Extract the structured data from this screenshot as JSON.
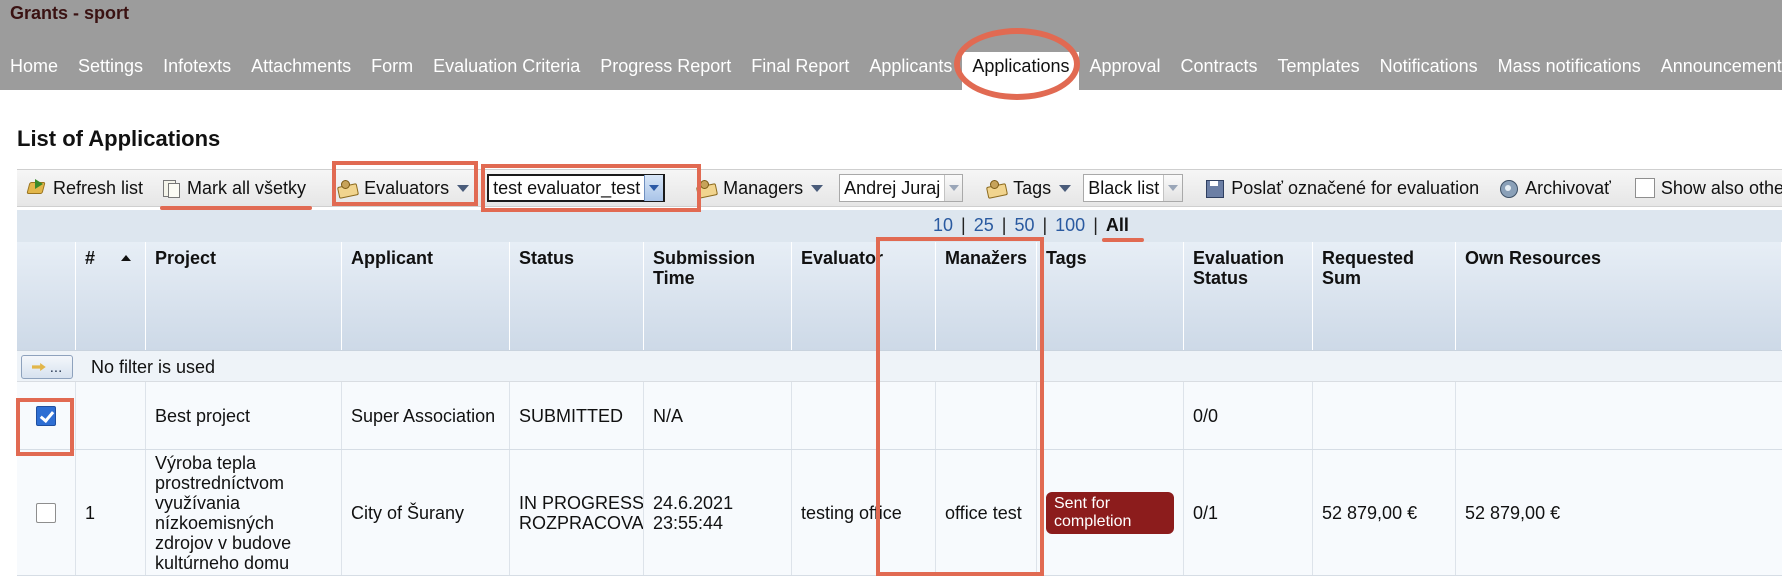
{
  "app": {
    "title": "Grants - sport"
  },
  "nav": {
    "items": [
      "Home",
      "Settings",
      "Infotexts",
      "Attachments",
      "Form",
      "Evaluation Criteria",
      "Progress Report",
      "Final Report",
      "Applicants",
      "Applications",
      "Approval",
      "Contracts",
      "Templates",
      "Notifications",
      "Mass notifications",
      "Announcements"
    ],
    "active": "Applications"
  },
  "page": {
    "title": "List of Applications"
  },
  "toolbar": {
    "refresh_label": "Refresh list",
    "mark_all_label": "Mark all všetky",
    "evaluators_label": "Evaluators",
    "evaluator_value": "test evaluator_test",
    "managers_label": "Managers",
    "manager_value": "Andrej Juraj",
    "tags_label": "Tags",
    "tag_value": "Black list",
    "send_label": "Poslať označené for evaluation",
    "archive_label": "Archivovať",
    "show_other_label": "Show also other"
  },
  "pager": {
    "options": [
      "10",
      "25",
      "50",
      "100",
      "All"
    ],
    "active": "All"
  },
  "table": {
    "columns": [
      "",
      "#",
      "Project",
      "Applicant",
      "Status",
      "Submission Time",
      "Evaluator",
      "Manažers",
      "Tags",
      "Evaluation Status",
      "Requested Sum",
      "Own Resources"
    ],
    "filter_button": "...",
    "filter_text": "No filter is used",
    "rows": [
      {
        "checked": true,
        "num": "",
        "project": "Best project",
        "applicant": "Super Association",
        "status": "SUBMITTED",
        "submission": "N/A",
        "evaluator": "",
        "managers": "",
        "tag": "",
        "eval_status": "0/0",
        "requested": "",
        "own": ""
      },
      {
        "checked": false,
        "num": "1",
        "project": "Výroba tepla prostredníctvom využívania nízkoemisných zdrojov v budove kultúrneho domu",
        "applicant": "City of Šurany",
        "status": "IN PROGRESS ROZPRACOVANÁ",
        "submission": "24.6.2021 23:55:44",
        "evaluator": "testing office",
        "managers": "office test",
        "tag": "Sent for completion",
        "eval_status": "0/1",
        "requested": "52 879,00 €",
        "own": "52 879,00 €"
      }
    ]
  },
  "colors": {
    "accent": "#e16a52",
    "header_bg": "#9c9c9c",
    "tag_bg": "#8c1c1c"
  }
}
